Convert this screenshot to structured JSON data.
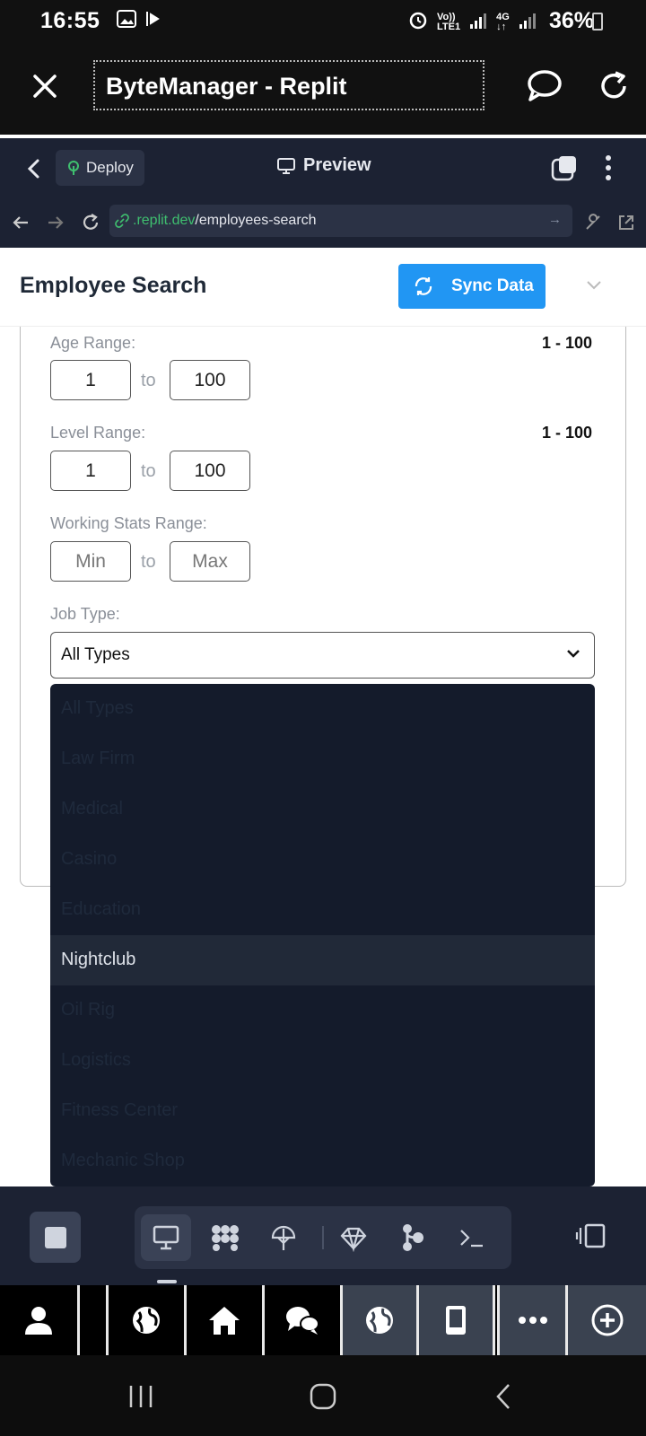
{
  "status_bar": {
    "time": "16:55",
    "battery": "36%",
    "network_top": "Vo))",
    "network_bottom": "LTE1",
    "network_4g": "4G"
  },
  "browser": {
    "title": "ByteManager - Replit"
  },
  "replit": {
    "deploy_label": "Deploy",
    "preview_label": "Preview",
    "url_host": ".replit.dev",
    "url_path": "/employees-search",
    "url_arrow": "→"
  },
  "app": {
    "title": "Employee Search",
    "sync_label": "Sync Data"
  },
  "form": {
    "age_label": "Age Range:",
    "age_value": "1 - 100",
    "age_min": "1",
    "age_max": "100",
    "level_label": "Level Range:",
    "level_value": "1 - 100",
    "level_min": "1",
    "level_max": "100",
    "stats_label": "Working Stats Range:",
    "stats_min_placeholder": "Min",
    "stats_max_placeholder": "Max",
    "to_label": "to",
    "job_label": "Job Type:",
    "job_selected": "All Types"
  },
  "dropdown": {
    "options": [
      "All Types",
      "Law Firm",
      "Medical",
      "Casino",
      "Education",
      "Nightclub",
      "Oil Rig",
      "Logistics",
      "Fitness Center",
      "Mechanic Shop"
    ],
    "highlighted": "Nightclub"
  },
  "colors": {
    "accent": "#2196f3",
    "replit_bg": "#1c2233",
    "dropdown_bg": "#141b2b",
    "url_green": "#3fbf6f"
  }
}
